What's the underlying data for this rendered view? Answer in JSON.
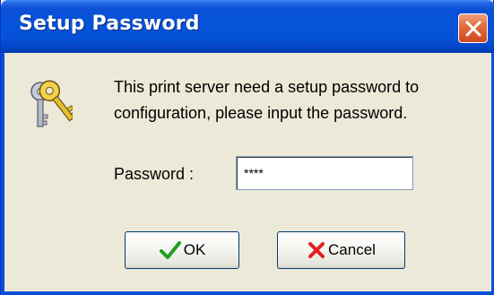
{
  "window": {
    "title": "Setup Password"
  },
  "title_bar": {
    "close_icon": "close-icon"
  },
  "content": {
    "icon": "keys-icon",
    "message": "This print server need a setup password to configuration, please input the password."
  },
  "form": {
    "password_label": "Password :",
    "password_value": "****"
  },
  "buttons": {
    "ok_label": "OK",
    "ok_icon": "checkmark-icon",
    "cancel_label": "Cancel",
    "cancel_icon": "x-mark-icon"
  },
  "colors": {
    "titlebar_blue": "#0553d9",
    "close_red": "#e06a3c",
    "dialog_face": "#ece9d8",
    "ok_check_green": "#22a020",
    "cancel_x_red": "#e02020"
  }
}
